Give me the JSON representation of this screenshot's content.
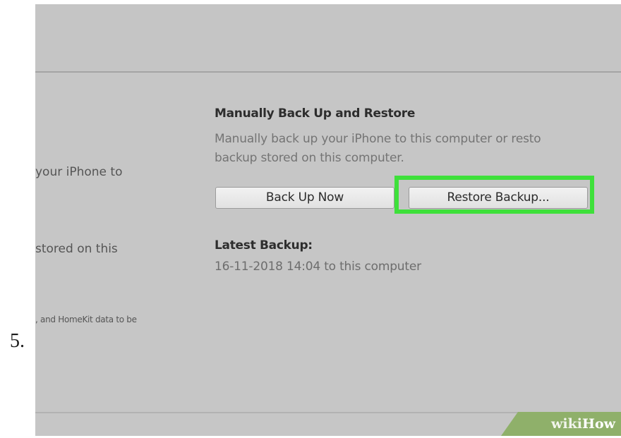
{
  "step_number": "5.",
  "left_column": {
    "line1": "your iPhone to",
    "line2": "stored on this",
    "line3": ", and HomeKit data to be"
  },
  "manual_backup": {
    "title": "Manually Back Up and Restore",
    "description_line1": "Manually back up your iPhone to this computer or resto",
    "description_line2": "backup stored on this computer.",
    "back_up_now_label": "Back Up Now",
    "restore_backup_label": "Restore Backup...",
    "highlight_color": "#3ee03a"
  },
  "latest_backup": {
    "title": "Latest Backup:",
    "value": "16-11-2018 14:04 to this computer"
  },
  "watermark": {
    "wiki": "wiki",
    "how": "How"
  }
}
